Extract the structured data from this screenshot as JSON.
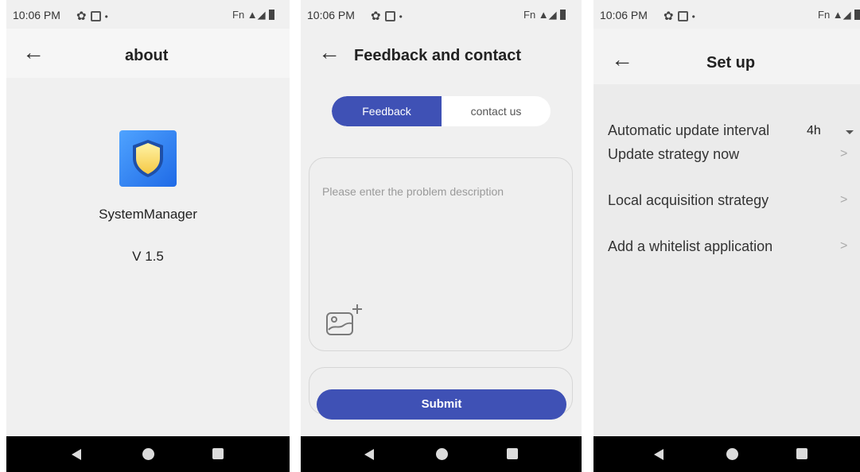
{
  "status_bar": {
    "time": "10:06 PM",
    "right_text": "Fn"
  },
  "about_screen": {
    "title": "about",
    "app_name": "SystemManager",
    "version": "V 1.5"
  },
  "feedback_screen": {
    "title": "Feedback and contact",
    "tabs": [
      {
        "label": "Feedback",
        "active": true
      },
      {
        "label": "contact us",
        "active": false
      }
    ],
    "placeholder": "Please enter the problem description",
    "submit_label": "Submit"
  },
  "setup_screen": {
    "title": "Set up",
    "items": [
      {
        "label": "Automatic update interval",
        "value": "4h",
        "control": "dropdown"
      },
      {
        "label": "Update strategy now",
        "control": "chevron"
      },
      {
        "label": "Local acquisition strategy",
        "control": "chevron"
      },
      {
        "label": "Add a whitelist application",
        "control": "chevron"
      }
    ]
  },
  "icons": {
    "back": "arrow-left-icon",
    "settings": "gear-icon",
    "app": "shield-icon",
    "image_add": "add-image-icon"
  },
  "colors": {
    "accent": "#3f51b5",
    "nav_bar": "#000000"
  }
}
